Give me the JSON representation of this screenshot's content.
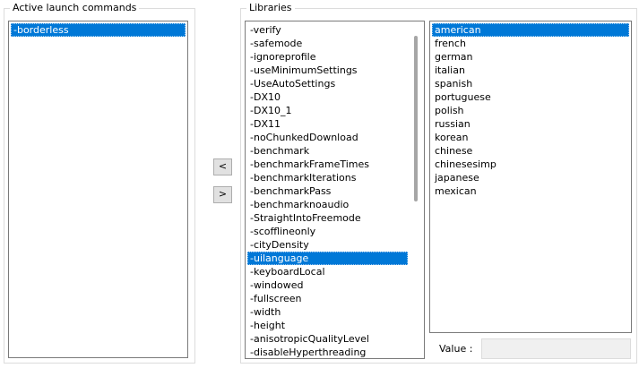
{
  "active": {
    "title": "Active launch commands",
    "items": [
      "-borderless"
    ],
    "selected_index": 0
  },
  "buttons": {
    "left": "<",
    "right": ">"
  },
  "libraries": {
    "title": "Libraries",
    "commands": [
      "-verify",
      "-safemode",
      "-ignoreprofile",
      "-useMinimumSettings",
      "-UseAutoSettings",
      "-DX10",
      "-DX10_1",
      "-DX11",
      "-noChunkedDownload",
      "-benchmark",
      "-benchmarkFrameTimes",
      "-benchmarkIterations",
      "-benchmarkPass",
      "-benchmarknoaudio",
      "-StraightIntoFreemode",
      "-scofflineonly",
      "-cityDensity",
      "-uilanguage",
      "-keyboardLocal",
      "-windowed",
      "-fullscreen",
      "-width",
      "-height",
      "-anisotropicQualityLevel",
      "-disableHyperthreading"
    ],
    "commands_selected_index": 17,
    "languages": [
      "american",
      "french",
      "german",
      "italian",
      "spanish",
      "portuguese",
      "polish",
      "russian",
      "korean",
      "chinese",
      "chinesesimp",
      "japanese",
      "mexican"
    ],
    "languages_selected_index": 0
  },
  "value": {
    "label": "Value :",
    "text": ""
  }
}
